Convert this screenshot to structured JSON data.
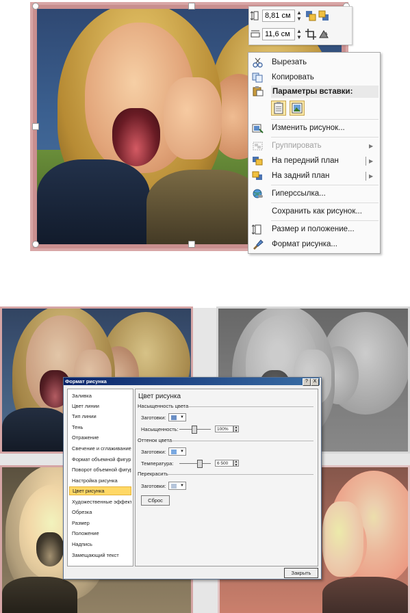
{
  "top": {
    "size": {
      "height_value": "8,81 см",
      "width_value": "11,6 см"
    },
    "context_menu": {
      "cut": "Вырезать",
      "copy": "Копировать",
      "paste_options": "Параметры вставки:",
      "change_picture": "Изменить рисунок...",
      "group": "Группировать",
      "bring_front": "На передний план",
      "send_back": "На задний план",
      "hyperlink": "Гиперссылка...",
      "save_as_picture": "Сохранить как рисунок...",
      "size_position": "Размер и положение...",
      "format_picture": "Формат рисунка..."
    }
  },
  "dialog": {
    "title": "Формат рисунка",
    "help": "?",
    "close_x": "X",
    "nav": [
      "Заливка",
      "Цвет линии",
      "Тип линии",
      "Тень",
      "Отражение",
      "Свечение и сглаживание",
      "Формат объемной фигуры",
      "Поворот объемной фигуры",
      "Настройка рисунка",
      "Цвет рисунка",
      "Художественные эффекты",
      "Обрезка",
      "Размер",
      "Положение",
      "Надпись",
      "Замещающий текст"
    ],
    "selected_index": 9,
    "panel": {
      "title": "Цвет рисунка",
      "saturation_section": "Насыщенность цвета",
      "presets_label_1": "Заготовки:",
      "saturation_label": "Насыщенность:",
      "saturation_value": "100%",
      "tone_section": "Оттенок цвета",
      "presets_label_2": "Заготовки:",
      "temperature_label": "Температура:",
      "temperature_value": "6 500",
      "recolor_section": "Перекрасить",
      "presets_label_3": "Заготовки:",
      "reset_button": "Сброс"
    },
    "close_button": "Закрыть"
  }
}
